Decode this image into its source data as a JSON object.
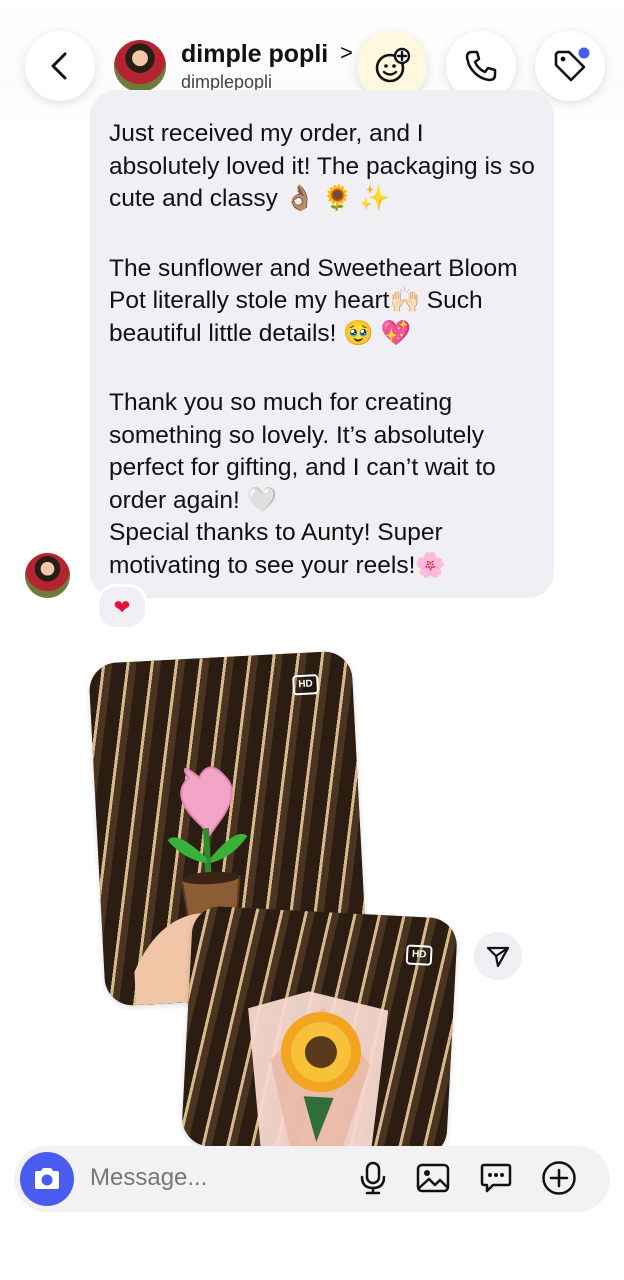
{
  "header": {
    "name": "dimple popli",
    "username": "dimplepopli",
    "chevron": ">"
  },
  "message": {
    "paragraphs": [
      "Just received my order, and I absolutely loved it! The packaging is so cute and classy 👌🏽 🌻 ✨",
      "The sunflower and Sweetheart Bloom Pot literally stole my heart🙌🏻 Such beautiful little details! 🥹 💖",
      "Thank you so much for creating something so lovely. It’s absolutely perfect for gifting, and I can’t wait to order again! 🤍",
      "Special thanks to Aunty! Super motivating to see your reels!🌸"
    ],
    "reaction": "❤"
  },
  "images": {
    "badge1": "HD",
    "badge2": "HD"
  },
  "composer": {
    "placeholder": "Message..."
  },
  "colors": {
    "accent": "#4a5cf0",
    "bubble": "#efeff4",
    "reaction": "#e0143c"
  },
  "icons": [
    "back-arrow-icon",
    "sticker-add-icon",
    "phone-icon",
    "tag-icon",
    "camera-icon",
    "microphone-icon",
    "gallery-icon",
    "chat-bubble-icon",
    "plus-icon",
    "send-icon"
  ]
}
